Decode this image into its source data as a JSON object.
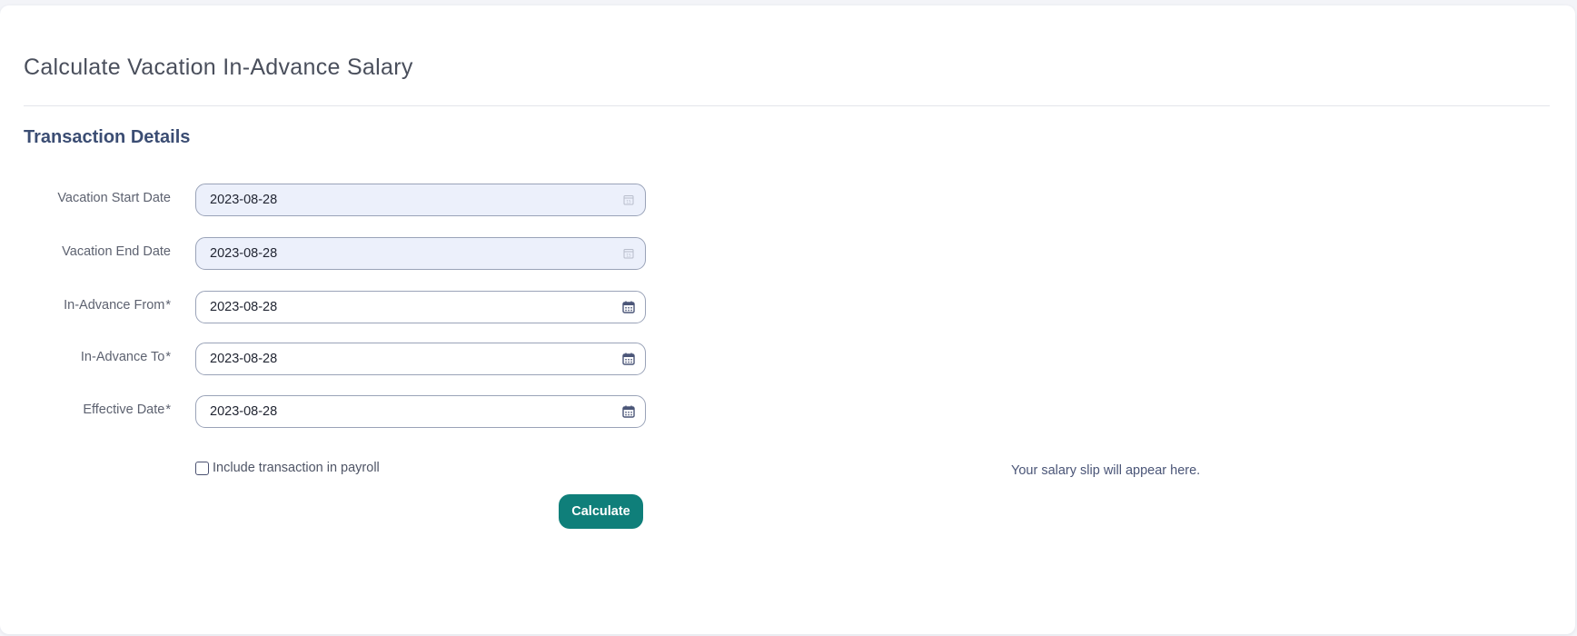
{
  "page": {
    "title": "Calculate Vacation In-Advance Salary"
  },
  "section": {
    "title": "Transaction Details"
  },
  "form": {
    "vacation_start": {
      "label": "Vacation Start Date",
      "value": "2023-08-28",
      "readonly": true
    },
    "vacation_end": {
      "label": "Vacation End Date",
      "value": "2023-08-28",
      "readonly": true
    },
    "in_advance_from": {
      "label": "In-Advance From",
      "required_mark": "*",
      "value": "2023-08-28"
    },
    "in_advance_to": {
      "label": "In-Advance To",
      "required_mark": "*",
      "value": "2023-08-28"
    },
    "effective_date": {
      "label": "Effective Date",
      "required_mark": "*",
      "value": "2023-08-28"
    },
    "include_in_payroll": {
      "label": "Include transaction in payroll",
      "checked": false
    },
    "calculate_label": "Calculate"
  },
  "salary_slip": {
    "placeholder": "Your salary slip will appear here."
  },
  "colors": {
    "primary_button": "#0f7f7a",
    "section_title": "#3b4d73",
    "readonly_field": "#ecf0fb"
  }
}
